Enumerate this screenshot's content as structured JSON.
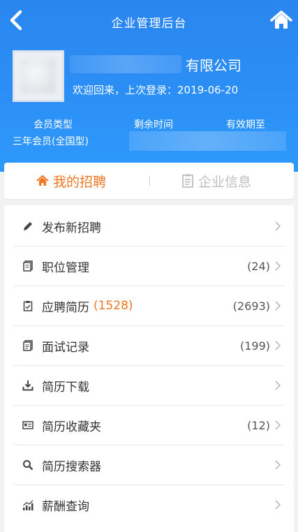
{
  "header": {
    "title": "企业管理后台",
    "company_suffix": "有限公司",
    "welcome": "欢迎回来，上次登录：2019-06-20"
  },
  "member": {
    "labels": [
      "会员类型",
      "剩余时间",
      "有效期至"
    ],
    "type_value": "三年会员(全国型)"
  },
  "tabs": {
    "recruit": "我的招聘",
    "company": "企业信息"
  },
  "menu": [
    {
      "label": "发布新招聘",
      "highlight": "",
      "count": "",
      "icon": "pencil-icon"
    },
    {
      "label": "职位管理",
      "highlight": "",
      "count": "(24)",
      "icon": "documents-icon"
    },
    {
      "label": "应聘简历",
      "highlight": "(1528)",
      "count": "(2693)",
      "icon": "clipboard-icon"
    },
    {
      "label": "面试记录",
      "highlight": "",
      "count": "(199)",
      "icon": "records-icon"
    },
    {
      "label": "简历下载",
      "highlight": "",
      "count": "",
      "icon": "download-icon"
    },
    {
      "label": "简历收藏夹",
      "highlight": "",
      "count": "(12)",
      "icon": "card-icon"
    },
    {
      "label": "简历搜索器",
      "highlight": "",
      "count": "",
      "icon": "search-icon"
    },
    {
      "label": "薪酬查询",
      "highlight": "",
      "count": "",
      "icon": "bar-chart-icon"
    }
  ],
  "colors": {
    "accent": "#f07622",
    "header_blue": "#2b8ff6"
  }
}
